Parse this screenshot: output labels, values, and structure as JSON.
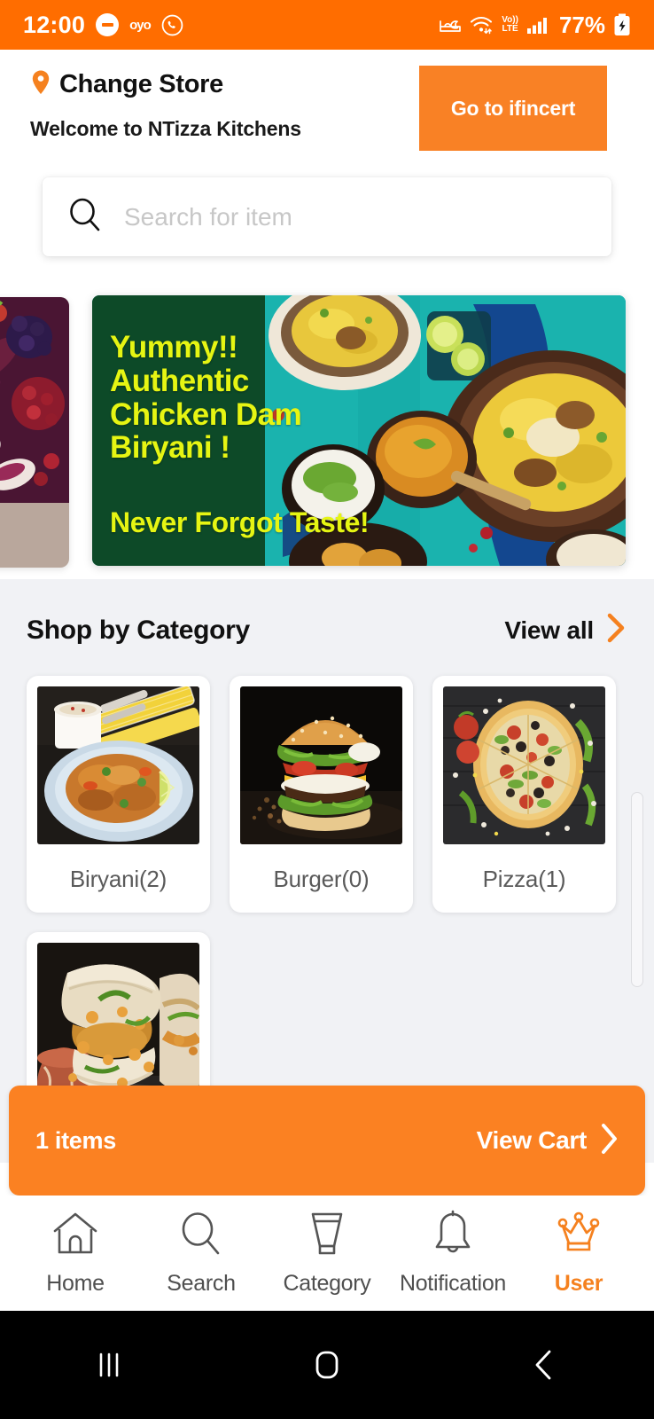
{
  "statusbar": {
    "time": "12:00",
    "dnd_icon": "do-not-disturb-icon",
    "oyo_label": "oyo",
    "whatsapp_icon": "whatsapp-icon",
    "alarm_icon": "sleep-mode-icon",
    "wifi_icon": "wifi-icon",
    "volte_top": "Vo))",
    "volte_bottom": "LTE",
    "signal_icon": "cellular-signal-icon",
    "battery_percent": "77%",
    "battery_icon": "battery-charging-icon",
    "bar_color": "#FF6D00"
  },
  "header": {
    "location_icon": "location-pin-icon",
    "change_store": "Change Store",
    "welcome": "Welcome to NTizza Kitchens",
    "go_button": "Go to ifincert",
    "accent_color": "#F98125"
  },
  "search": {
    "icon": "search-icon",
    "placeholder": "Search for item",
    "value": ""
  },
  "banner": {
    "headline": "Yummy!!\nAuthentic\nChicken Dam\nBiryani !",
    "subline": "Never Forgot Taste!",
    "text_color": "#E6F513",
    "peek_label": "vegetables-banner"
  },
  "category_section": {
    "title": "Shop by Category",
    "view_all": "View all",
    "view_all_icon": "chevron-right-icon",
    "items": [
      {
        "label": "Biryani(2)",
        "image": "biryani-photo"
      },
      {
        "label": "Burger(0)",
        "image": "burger-photo"
      },
      {
        "label": "Pizza(1)",
        "image": "pizza-photo"
      },
      {
        "label": "",
        "image": "vada-pav-photo"
      }
    ]
  },
  "cart_bar": {
    "items_label": "1 items",
    "view_cart": "View Cart",
    "chevron_icon": "chevron-right-icon",
    "color": "#FB8122"
  },
  "bottom_nav": {
    "active_color": "#F5811F",
    "items": [
      {
        "label": "Home",
        "icon": "home-icon",
        "active": false
      },
      {
        "label": "Search",
        "icon": "search-icon",
        "active": false
      },
      {
        "label": "Category",
        "icon": "funnel-icon",
        "active": false
      },
      {
        "label": "Notification",
        "icon": "bell-icon",
        "active": false
      },
      {
        "label": "User",
        "icon": "crown-icon",
        "active": true
      }
    ]
  },
  "system_nav": {
    "recents_icon": "recents-icon",
    "home_icon": "home-square-icon",
    "back_icon": "back-chevron-icon"
  }
}
